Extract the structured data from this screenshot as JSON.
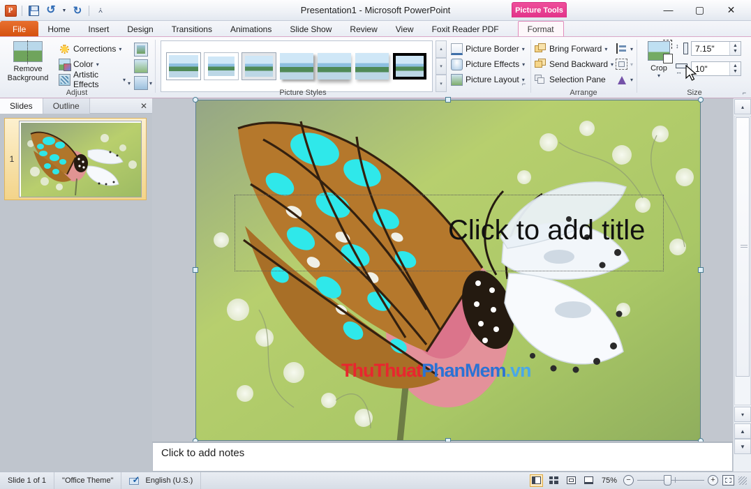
{
  "window": {
    "title": "Presentation1  -  Microsoft PowerPoint",
    "contextual_tab_title": "Picture Tools",
    "minimize": "—",
    "maximize": "▢",
    "close": "✕",
    "help": "?",
    "collapse_ribbon": "⌃"
  },
  "quick_access": {
    "app_logo": "P",
    "items": [
      {
        "name": "save-icon",
        "label": "Save"
      },
      {
        "name": "undo-icon",
        "label": "↺"
      },
      {
        "name": "undo-dropdown-icon",
        "label": "▾"
      },
      {
        "name": "redo-icon",
        "label": "↻"
      },
      {
        "name": "customize-qat-icon",
        "label": "▾"
      }
    ]
  },
  "tabs": [
    {
      "label": "File",
      "type": "file"
    },
    {
      "label": "Home",
      "type": "normal"
    },
    {
      "label": "Insert",
      "type": "normal"
    },
    {
      "label": "Design",
      "type": "normal"
    },
    {
      "label": "Transitions",
      "type": "normal"
    },
    {
      "label": "Animations",
      "type": "normal"
    },
    {
      "label": "Slide Show",
      "type": "normal"
    },
    {
      "label": "Review",
      "type": "normal"
    },
    {
      "label": "View",
      "type": "normal"
    },
    {
      "label": "Foxit Reader PDF",
      "type": "normal"
    },
    {
      "label": "Format",
      "type": "contextual",
      "active": true
    }
  ],
  "ribbon": {
    "adjust": {
      "group_label": "Adjust",
      "remove_background": "Remove\nBackground",
      "remove_background_line1": "Remove",
      "remove_background_line2": "Background",
      "corrections": "Corrections",
      "color": "Color",
      "artistic_effects": "Artistic Effects",
      "compress_pictures": "Compress Pictures",
      "change_picture": "Change Picture",
      "reset_picture": "Reset Picture",
      "caret": "▾"
    },
    "picture_styles": {
      "group_label": "Picture Styles",
      "styles": [
        "Simple Frame, White",
        "Beveled Matte, White",
        "Metal Frame",
        "Drop Shadow Rectangle",
        "Reflected Rounded Rectangle",
        "Soft Edge Rectangle",
        "Simple Frame, Black"
      ],
      "selected_index": 6,
      "scroll_up": "▴",
      "scroll_down": "▾",
      "more": "▾",
      "picture_border": "Picture Border",
      "picture_effects": "Picture Effects",
      "picture_layout": "Picture Layout",
      "dialog_launcher": "⌐"
    },
    "arrange": {
      "group_label": "Arrange",
      "bring_forward": "Bring Forward",
      "send_backward": "Send Backward",
      "selection_pane": "Selection Pane",
      "align": "Align",
      "group": "Group",
      "rotate": "Rotate",
      "caret": "▾"
    },
    "size": {
      "group_label": "Size",
      "crop": "Crop",
      "crop_caret": "▾",
      "height_label": "Shape Height",
      "height_value": "7.15\"",
      "width_label": "Shape Width",
      "width_value": "10\"",
      "spin_up": "▲",
      "spin_down": "▼",
      "dialog_launcher": "⌐"
    }
  },
  "left_pane": {
    "tabs": [
      {
        "label": "Slides",
        "active": true
      },
      {
        "label": "Outline",
        "active": false
      }
    ],
    "close": "✕",
    "slides": [
      {
        "number": "1"
      }
    ]
  },
  "slide": {
    "title_placeholder": "Click to add title",
    "watermark": {
      "part1": "ThuThuat",
      "part2": "PhanMem",
      "part3": ".vn"
    }
  },
  "notes": {
    "placeholder": "Click to add notes"
  },
  "scrollbar": {
    "up": "▴",
    "down": "▾",
    "previous_slide": "▲",
    "next_slide": "▼"
  },
  "status_bar": {
    "slide_count": "Slide 1 of 1",
    "theme": "\"Office Theme\"",
    "language": "English (U.S.)",
    "spellcheck_label": "Spelling Check",
    "views": [
      {
        "name": "normal-view-button",
        "label": "Normal",
        "active": true
      },
      {
        "name": "slide-sorter-view-button",
        "label": "Slide Sorter",
        "active": false
      },
      {
        "name": "reading-view-button",
        "label": "Reading View",
        "active": false
      },
      {
        "name": "slide-show-button",
        "label": "Slide Show",
        "active": false
      }
    ],
    "zoom_level": "75%",
    "zoom_out": "−",
    "zoom_in": "+",
    "fit_to_window": "Fit slide to current window"
  },
  "colors": {
    "file_tab": "#d4500f",
    "contextual_pink": "#e2338a",
    "accent_blue": "#2f6bb5",
    "watermark_red": "#e8262f",
    "watermark_blue": "#2b72d4",
    "watermark_lightblue": "#4aa8e8"
  }
}
